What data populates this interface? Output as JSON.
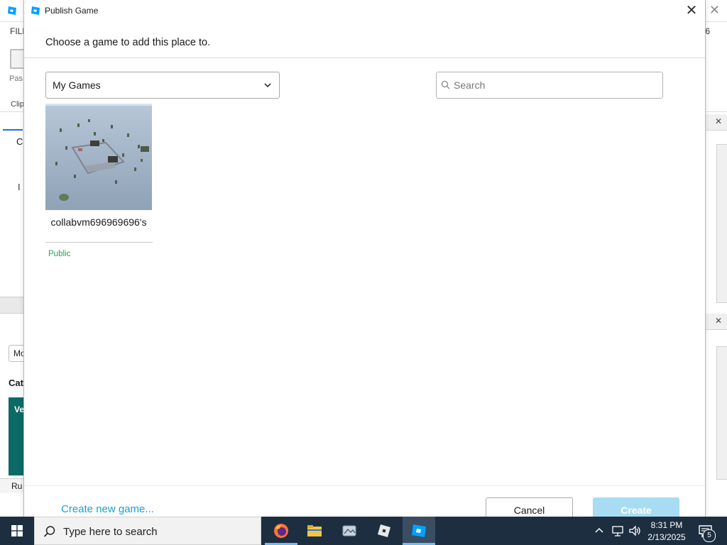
{
  "background": {
    "menu_file": "FILE",
    "menu_right": "6",
    "paste_label": "Pas",
    "clipboard_label": "Clip",
    "left_tab": "C",
    "left_i": "I",
    "left_mo": "Mo",
    "left_cat": "Cat",
    "left_card": "Ve",
    "left_run": "Ru"
  },
  "dialog": {
    "title": "Publish Game",
    "subtitle": "Choose a game to add this place to.",
    "dropdown": {
      "selected": "My Games"
    },
    "search": {
      "placeholder": "Search",
      "value": ""
    },
    "games": [
      {
        "name": "collabvm696969696's",
        "status": "Public"
      }
    ],
    "create_link": "Create new game...",
    "cancel_label": "Cancel",
    "create_label": "Create"
  },
  "taskbar": {
    "search_placeholder": "Type here to search",
    "apps": [
      "firefox-icon",
      "file-explorer-icon",
      "photos-icon",
      "roblox-player-icon",
      "roblox-studio-icon"
    ],
    "time": "8:31 PM",
    "date": "2/13/2025",
    "notification_count": "5"
  },
  "colors": {
    "accent_link": "#1a9fd6",
    "create_disabled": "#a8dcf2",
    "status_public": "#2aa05a",
    "taskbar": "#1c2e40"
  }
}
